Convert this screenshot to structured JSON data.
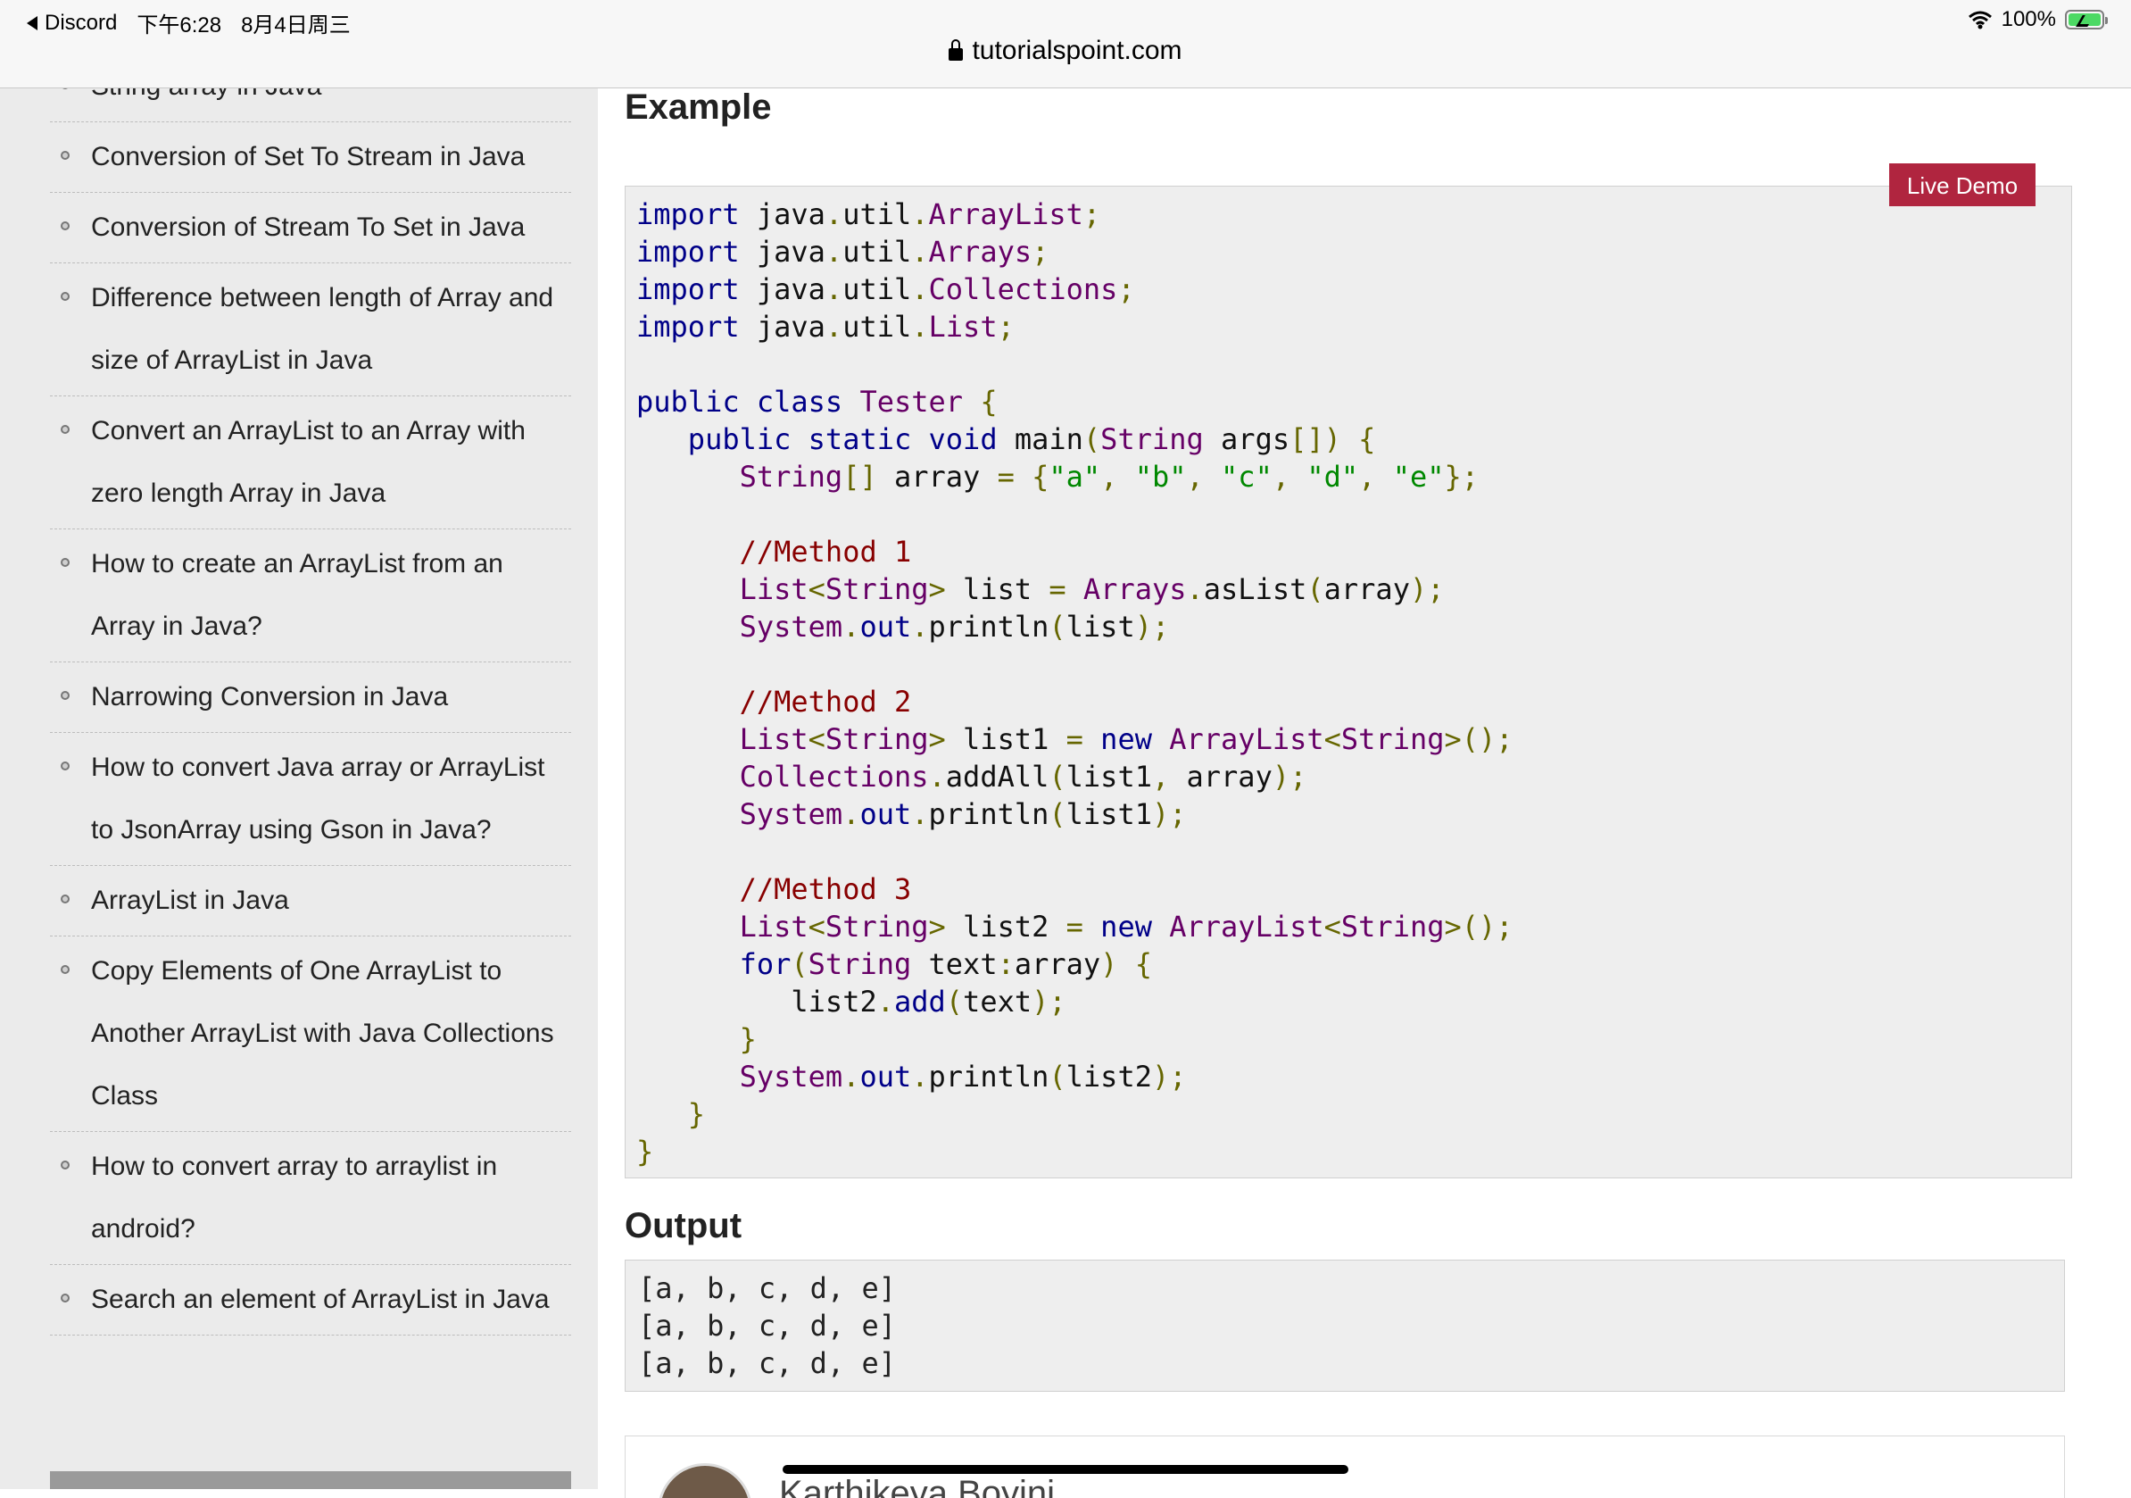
{
  "status_bar": {
    "back_app": "Discord",
    "time": "下午6:28",
    "date": "8月4日周三",
    "battery": "100%"
  },
  "address_bar": {
    "url": "tutorialspoint.com"
  },
  "sidebar": {
    "items": [
      {
        "label": "String array in Java"
      },
      {
        "label": "Conversion of Set To Stream in Java"
      },
      {
        "label": "Conversion of Stream To Set in Java"
      },
      {
        "label": "Difference between length of Array and size of ArrayList in Java"
      },
      {
        "label": "Convert an ArrayList to an Array with zero length Array in Java"
      },
      {
        "label": "How to create an ArrayList from an Array in Java?"
      },
      {
        "label": "Narrowing Conversion in Java"
      },
      {
        "label": "How to convert Java array or ArrayList to JsonArray using Gson in Java?"
      },
      {
        "label": "ArrayList in Java"
      },
      {
        "label": "Copy Elements of One ArrayList to Another ArrayList with Java Collections Class"
      },
      {
        "label": "How to convert array to arraylist in android?"
      },
      {
        "label": "Search an element of ArrayList in Java"
      }
    ]
  },
  "main": {
    "example_heading": "Example",
    "live_demo_label": "Live Demo",
    "code_lines": [
      "import java.util.ArrayList;",
      "import java.util.Arrays;",
      "import java.util.Collections;",
      "import java.util.List;",
      "",
      "public class Tester {",
      "   public static void main(String args[]) {",
      "      String[] array = {\"a\", \"b\", \"c\", \"d\", \"e\"};",
      "",
      "      //Method 1",
      "      List<String> list = Arrays.asList(array);",
      "      System.out.println(list);",
      "",
      "      //Method 2",
      "      List<String> list1 = new ArrayList<String>();",
      "      Collections.addAll(list1, array);",
      "      System.out.println(list1);",
      "",
      "      //Method 3",
      "      List<String> list2 = new ArrayList<String>();",
      "      for(String text:array) {",
      "         list2.add(text);",
      "      }",
      "      System.out.println(list2);",
      "   }",
      "}"
    ],
    "output_heading": "Output",
    "output_lines": [
      "[a, b, c, d, e]",
      "[a, b, c, d, e]",
      "[a, b, c, d, e]"
    ],
    "author_name": "Karthikeya Boyini"
  },
  "colors": {
    "live_demo_bg": "#b0253f",
    "sidebar_bg": "#ebebeb",
    "code_bg": "#eeeeee",
    "keyword": "#000088",
    "type": "#660066",
    "punctuation": "#666600",
    "string": "#008800",
    "comment": "#880000"
  },
  "icons": [
    "back-arrow-icon",
    "lock-icon",
    "wifi-icon",
    "battery-charging-icon",
    "bullet-icon"
  ]
}
